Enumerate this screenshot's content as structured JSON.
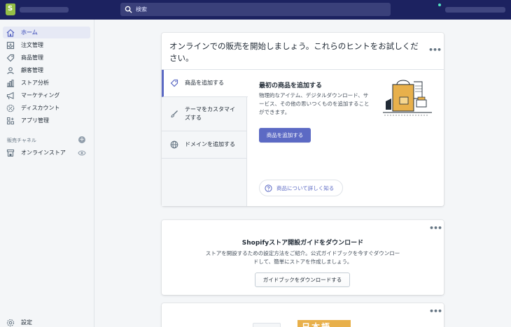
{
  "colors": {
    "topbar": "#1c2260",
    "accent": "#5c6ac4",
    "brand_logo": "#95bf47",
    "illustration": "#e8b04b"
  },
  "topbar": {
    "search_placeholder": "検索"
  },
  "sidebar": {
    "items": [
      {
        "label": "ホーム",
        "icon": "home-icon",
        "active": true
      },
      {
        "label": "注文管理",
        "icon": "orders-icon"
      },
      {
        "label": "商品管理",
        "icon": "tag-icon"
      },
      {
        "label": "顧客管理",
        "icon": "customer-icon"
      },
      {
        "label": "ストア分析",
        "icon": "analytics-icon"
      },
      {
        "label": "マーケティング",
        "icon": "megaphone-icon"
      },
      {
        "label": "ディスカウント",
        "icon": "discount-icon"
      },
      {
        "label": "アプリ管理",
        "icon": "apps-icon"
      }
    ],
    "channels_label": "販売チャネル",
    "online_store": "オンラインストア",
    "settings": "設定"
  },
  "hints_card": {
    "title": "オンラインでの販売を開始しましょう。これらのヒントをお試しください。",
    "tabs": [
      {
        "label": "商品を追加する",
        "icon": "tag-icon"
      },
      {
        "label": "テーマをカスタマイズする",
        "icon": "brush-icon"
      },
      {
        "label": "ドメインを追加する",
        "icon": "globe-icon"
      }
    ],
    "pane": {
      "title": "最初の商品を追加する",
      "description": "物理的なアイテム、デジタルダウンロード、サービス、その他の思いつくものを追加することができます。",
      "primary_button": "商品を追加する",
      "learn_more": "商品について詳しく知る"
    }
  },
  "guide_card": {
    "title": "Shopifyストア開設ガイドをダウンロード",
    "description": "ストアを開設するための設定方法をご紹介。公式ガイドブックを今すぐダウンロードして、簡単にストアを作成しましょう。",
    "button": "ガイドブックをダウンロードする"
  },
  "peek_card": {
    "banner_text": "日本語"
  }
}
